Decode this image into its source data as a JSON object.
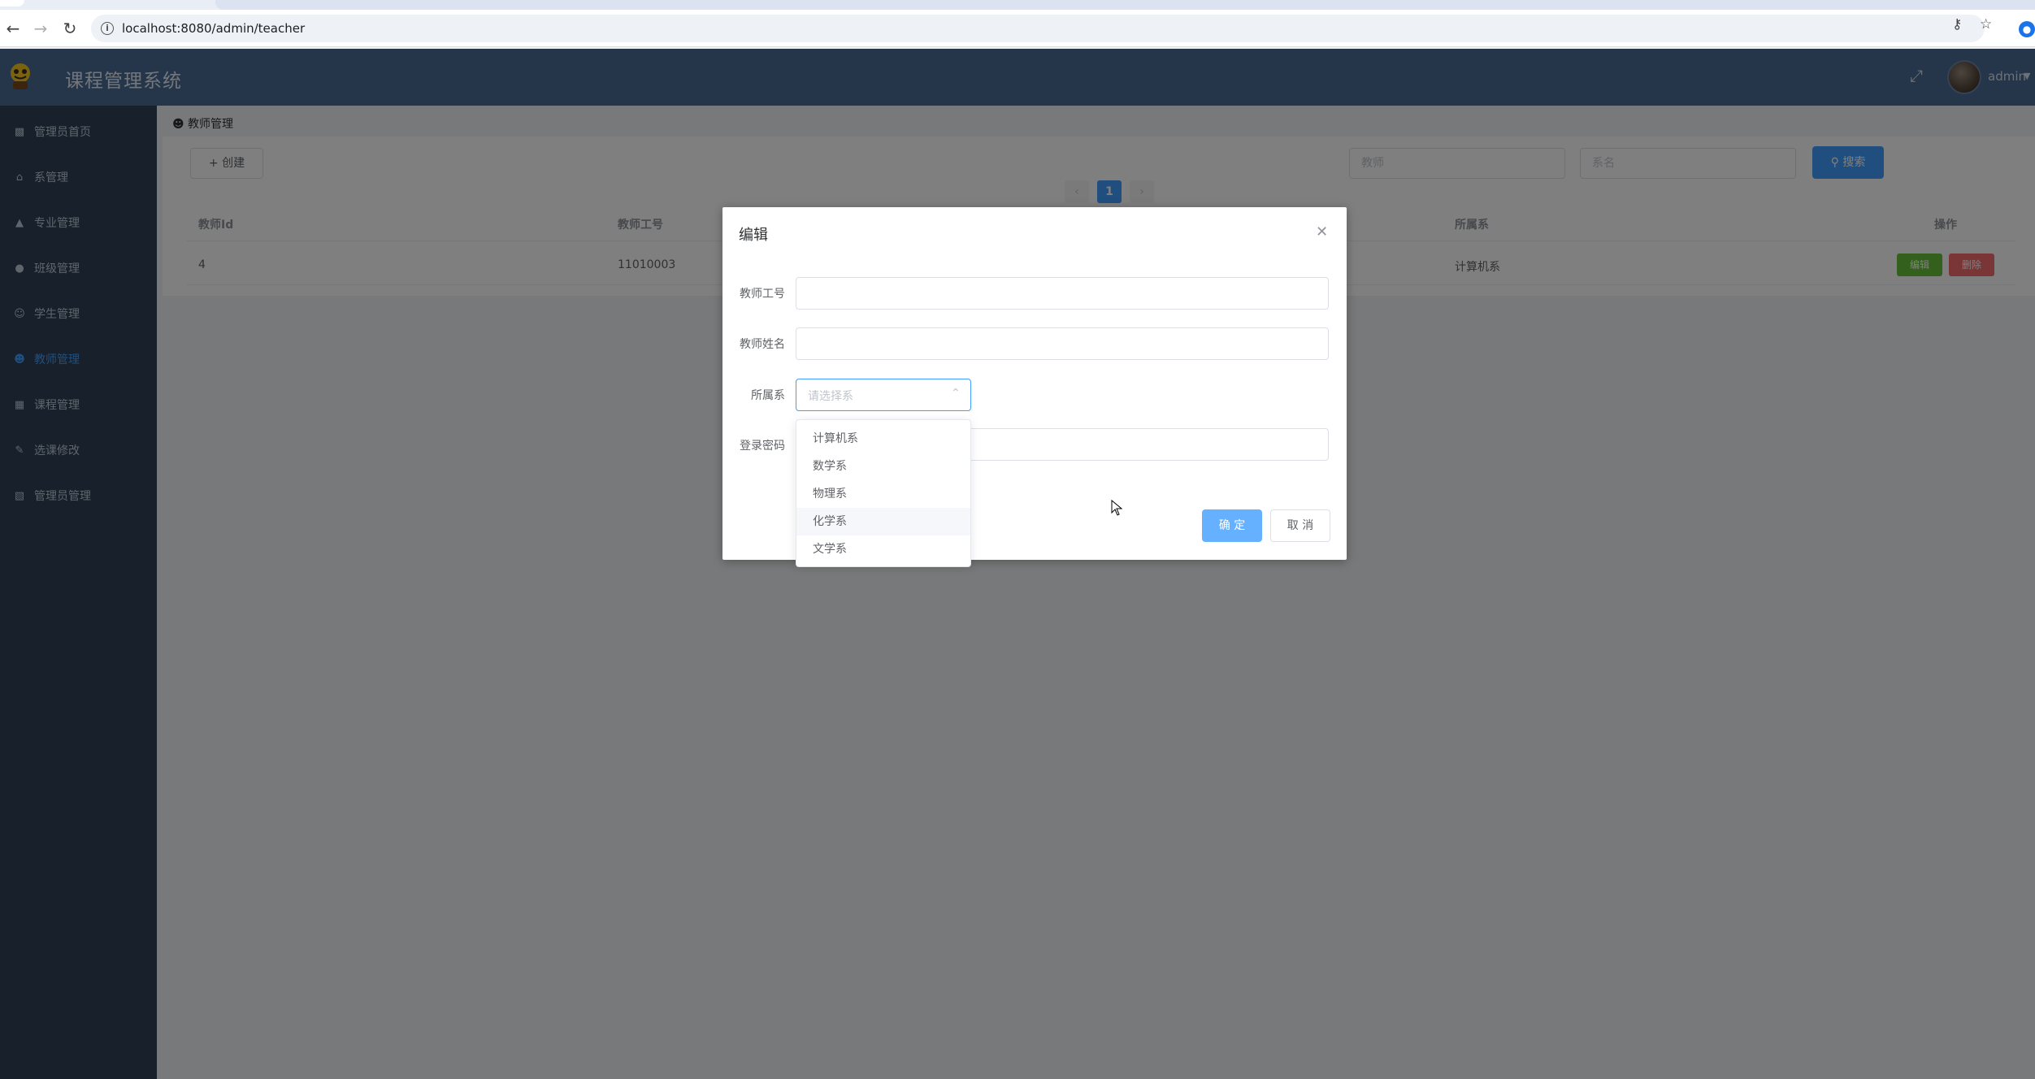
{
  "browser": {
    "url": "localhost:8080/admin/teacher",
    "back_icon": "arrow-left-icon",
    "forward_icon": "arrow-right-icon",
    "reload_icon": "reload-icon"
  },
  "app": {
    "title": "课程管理系统",
    "user": "admin"
  },
  "sidebar": {
    "items": [
      {
        "label": "管理员首页",
        "icon": "chart-icon"
      },
      {
        "label": "系管理",
        "icon": "home-icon"
      },
      {
        "label": "专业管理",
        "icon": "graduation-icon"
      },
      {
        "label": "班级管理",
        "icon": "group-icon"
      },
      {
        "label": "学生管理",
        "icon": "user-icon"
      },
      {
        "label": "教师管理",
        "icon": "user-add-icon"
      },
      {
        "label": "课程管理",
        "icon": "book-icon"
      },
      {
        "label": "选课修改",
        "icon": "edit-icon"
      },
      {
        "label": "管理员管理",
        "icon": "admin-icon"
      }
    ]
  },
  "breadcrumb": "教师管理",
  "toolbar": {
    "create_label": "创建",
    "search_placeholder_1": "教师",
    "search_placeholder_2": "系名",
    "search_label": "搜索"
  },
  "pagination": {
    "current_page": "1"
  },
  "table": {
    "headers": [
      "教师Id",
      "教师工号",
      "所属系",
      "操作"
    ],
    "rows": [
      {
        "id": "4",
        "number": "11010003",
        "department": "计算机系",
        "edit": "编辑",
        "delete": "删除"
      }
    ]
  },
  "dialog": {
    "title": "编辑",
    "fields": {
      "teacher_number_label": "教师工号",
      "teacher_name_label": "教师姓名",
      "department_label": "所属系",
      "department_placeholder": "请选择系",
      "password_label": "登录密码"
    },
    "ok_label": "确 定",
    "cancel_label": "取 消"
  },
  "dropdown": {
    "options": [
      "计算机系",
      "数学系",
      "物理系",
      "化学系",
      "文学系"
    ],
    "hovered_index": 3
  },
  "colors": {
    "header": "#4a6a94",
    "sidebar": "#304156",
    "active": "#409eff",
    "success": "#67c23a",
    "danger": "#f56c6c"
  }
}
